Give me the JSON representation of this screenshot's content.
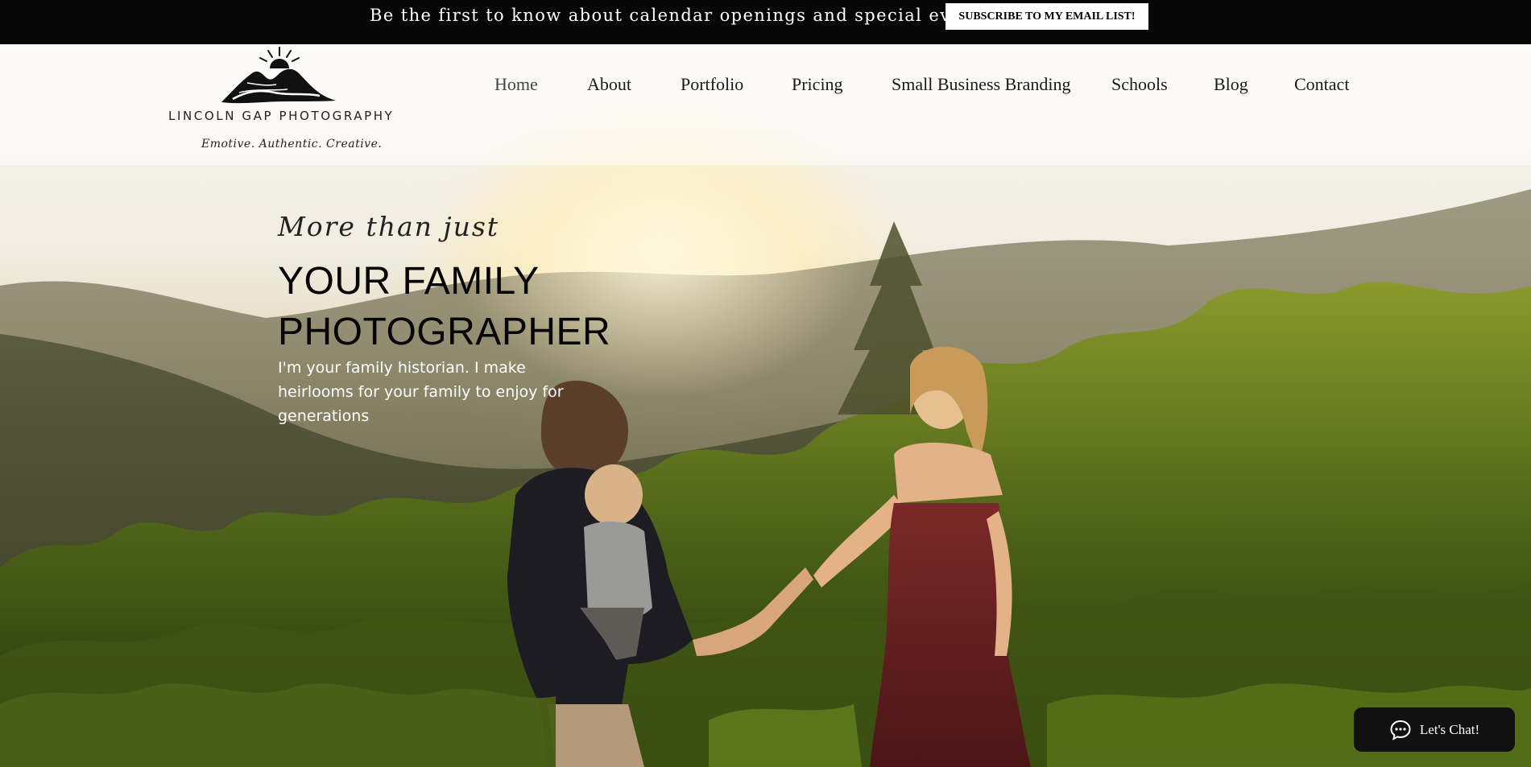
{
  "announcement": {
    "text": "Be the first to know about calendar openings and special events!",
    "button_label": "SUBSCRIBE TO MY EMAIL LIST!"
  },
  "logo": {
    "name": "LINCOLN GAP PHOTOGRAPHY",
    "tagline": "Emotive. Authentic. Creative."
  },
  "nav": {
    "items": [
      {
        "label": "Home"
      },
      {
        "label": "About"
      },
      {
        "label": "Portfolio"
      },
      {
        "label": "Pricing"
      },
      {
        "label": "Small Business Branding"
      },
      {
        "label": "Schools"
      },
      {
        "label": "Blog"
      },
      {
        "label": "Contact"
      }
    ],
    "active": "Home"
  },
  "hero": {
    "kicker": "More than just",
    "title_line1": "YOUR FAMILY",
    "title_line2": "PHOTOGRAPHER",
    "body": "I'm your family historian. I make heirlooms for your family to enjoy for generations"
  },
  "chat": {
    "label": "Let's Chat!",
    "icon": "chat-bubble-icon"
  },
  "colors": {
    "announcement_bg": "#070707",
    "text_dark": "#1a1a1a",
    "chat_bg": "#111111"
  }
}
